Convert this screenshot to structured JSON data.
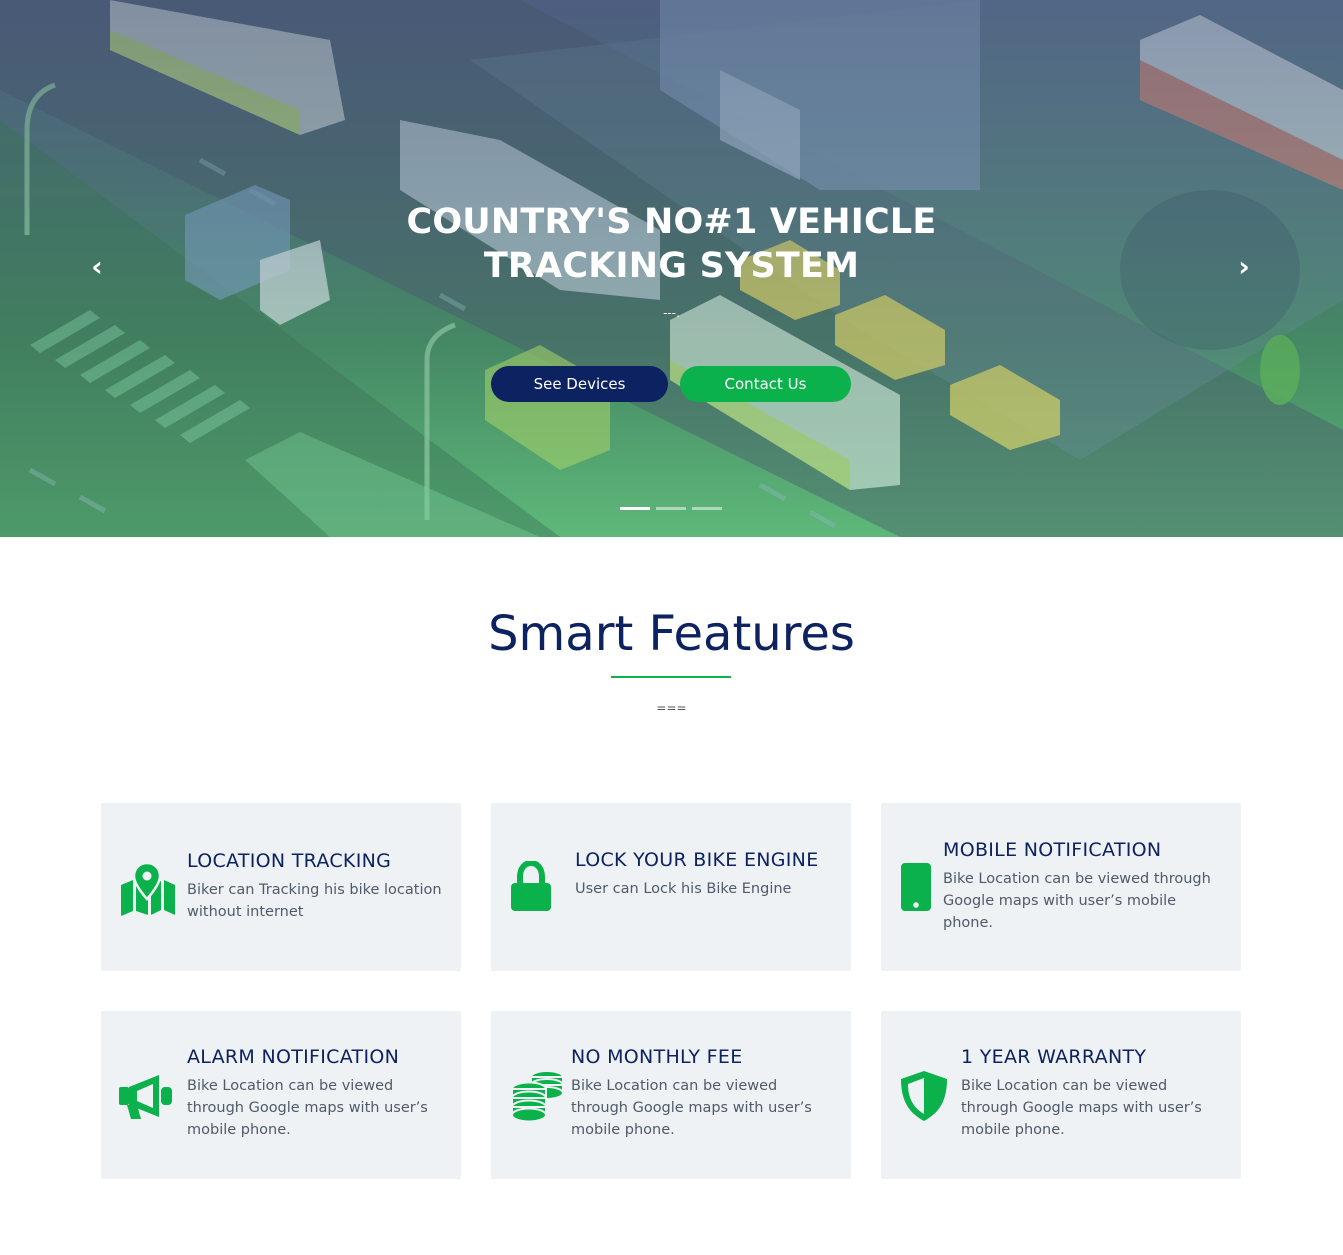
{
  "hero": {
    "title": "COUNTRY'S NO#1 VEHICLE TRACKING SYSTEM",
    "subtitle": "---.",
    "buttons": {
      "devices": "See Devices",
      "contact": "Contact Us"
    },
    "arrows": {
      "prev": "‹",
      "next": "›"
    },
    "slides_count": 3,
    "active_slide": 1
  },
  "features": {
    "title": "Smart Features",
    "subtitle": "===",
    "items": [
      {
        "icon": "map-marker-icon",
        "title": "LOCATION TRACKING",
        "text": "Biker can Tracking his bike location without internet"
      },
      {
        "icon": "lock-icon",
        "title": "LOCK YOUR BIKE ENGINE",
        "text": "User can Lock his Bike Engine"
      },
      {
        "icon": "mobile-phone-icon",
        "title": "MOBILE NOTIFICATION",
        "text": "Bike Location can be viewed through Google maps with user’s mobile phone."
      },
      {
        "icon": "megaphone-icon",
        "title": "ALARM NOTIFICATION",
        "text": "Bike Location can be viewed through Google maps with user’s mobile phone."
      },
      {
        "icon": "coins-icon",
        "title": "NO MONTHLY FEE",
        "text": "Bike Location can be viewed through Google maps with user’s mobile phone."
      },
      {
        "icon": "shield-icon",
        "title": "1 YEAR WARRANTY",
        "text": "Bike Location can be viewed through Google maps with user’s mobile phone."
      }
    ]
  },
  "colors": {
    "navy": "#0d2260",
    "green": "#0bb24c",
    "card_bg": "#eff2f5"
  }
}
